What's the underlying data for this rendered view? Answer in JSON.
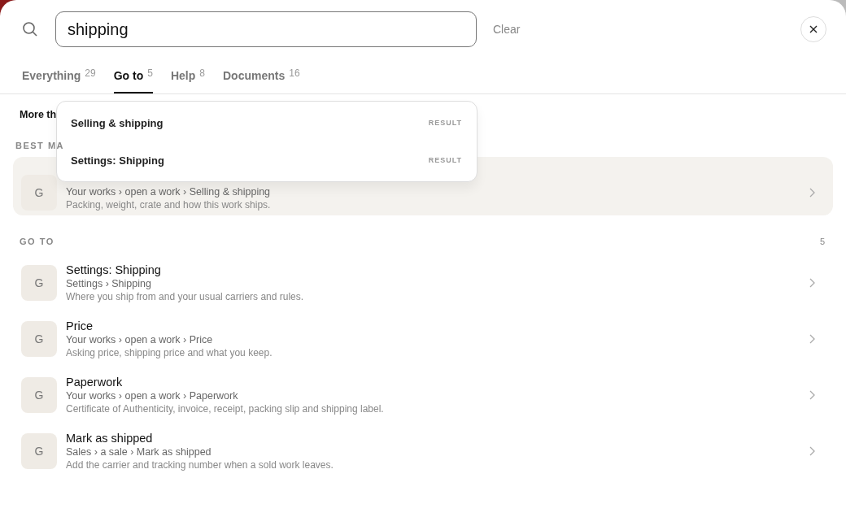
{
  "search": {
    "value": "shipping",
    "clear": "Clear"
  },
  "tabs": [
    {
      "label": "Everything",
      "count": "29",
      "selected": false
    },
    {
      "label": "Go to",
      "count": "5",
      "selected": true
    },
    {
      "label": "Help",
      "count": "8",
      "selected": false
    },
    {
      "label": "Documents",
      "count": "16",
      "selected": false
    }
  ],
  "notice": "More th",
  "best_match": {
    "heading": "BEST MA",
    "item": {
      "avatar": "G",
      "breadcrumb": "Your works › open a work › Selling & shipping",
      "description": "Packing, weight, crate and how this work ships.",
      "selected": true
    }
  },
  "go_to": {
    "heading": "GO TO",
    "count": "5",
    "items": [
      {
        "avatar": "G",
        "title": "Settings: Shipping",
        "breadcrumb": "Settings › Shipping",
        "description": "Where you ship from and your usual carriers and rules.",
        "selected": false
      },
      {
        "avatar": "G",
        "title": "Price",
        "breadcrumb": "Your works › open a work › Price",
        "description": "Asking price, shipping price and what you keep.",
        "selected": false
      },
      {
        "avatar": "G",
        "title": "Paperwork",
        "breadcrumb": "Your works › open a work › Paperwork",
        "description": "Certificate of Authenticity, invoice, receipt, packing slip and shipping label.",
        "selected": false
      },
      {
        "avatar": "G",
        "title": "Mark as shipped",
        "breadcrumb": "Sales › a sale › Mark as shipped",
        "description": "Add the carrier and tracking number when a sold work leaves.",
        "selected": false
      }
    ]
  },
  "suggestions": [
    {
      "label": "Selling & shipping",
      "tag": "RESULT"
    },
    {
      "label": "Settings: Shipping",
      "tag": "RESULT"
    }
  ]
}
